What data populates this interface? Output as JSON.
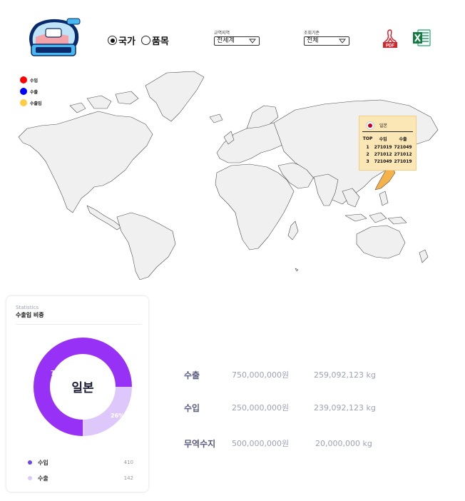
{
  "header": {
    "radio_options": [
      {
        "label": "국가",
        "selected": true
      },
      {
        "label": "품목",
        "selected": false
      }
    ],
    "region_select": {
      "label": "교역지역",
      "value": "전세계"
    },
    "basis_select": {
      "label": "조회기준",
      "value": "전체"
    },
    "pdf_icon_text": "PDF"
  },
  "map_legend": [
    {
      "label": "수입",
      "color": "#ff0000"
    },
    {
      "label": "수출",
      "color": "#0000ff"
    },
    {
      "label": "수출입",
      "color": "#ffcc44"
    }
  ],
  "tooltip": {
    "country": "일본",
    "headers": [
      "TOP",
      "수입",
      "수출"
    ],
    "rows": [
      [
        "1",
        "271019",
        "721049"
      ],
      [
        "2",
        "271012",
        "271012"
      ],
      [
        "3",
        "721049",
        "271019"
      ]
    ]
  },
  "stats_card": {
    "subtitle": "Statistics",
    "title": "수출입 비중",
    "center_label": "일본",
    "slices": [
      {
        "name": "수입",
        "percent": 75,
        "label": "75%",
        "color": "#9631f5"
      },
      {
        "name": "수출",
        "percent": 25,
        "label": "26%",
        "color": "#dec8fb"
      }
    ],
    "legend": [
      {
        "label": "수입",
        "value": "410",
        "color": "#6c48ef"
      },
      {
        "label": "수출",
        "value": "142",
        "color": "#dcc7fa"
      }
    ]
  },
  "summary": [
    {
      "label": "수출",
      "amount": "750,000,000원",
      "weight": "259,092,123 kg"
    },
    {
      "label": "수입",
      "amount": "250,000,000원",
      "weight": "239,092,123 kg"
    },
    {
      "label": "무역수지",
      "amount": "500,000,000원",
      "weight": "20,000,000 kg"
    }
  ]
}
